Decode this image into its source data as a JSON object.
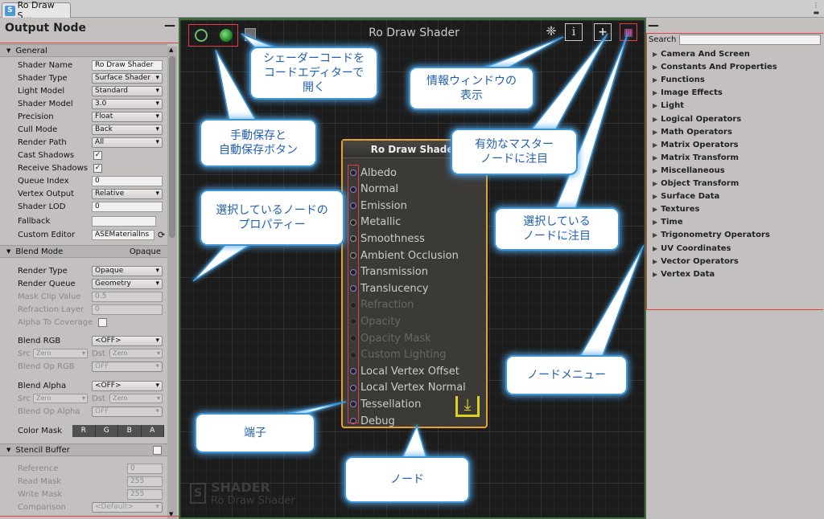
{
  "window": {
    "tab_title": "Ro Draw S...",
    "tab_icon": "S"
  },
  "left_panel": {
    "title": "Output Node",
    "minimize": "—",
    "general": {
      "header": "General",
      "shader_name": {
        "label": "Shader Name",
        "value": "Ro Draw Shader"
      },
      "shader_type": {
        "label": "Shader Type",
        "value": "Surface Shader"
      },
      "light_model": {
        "label": "Light Model",
        "value": "Standard"
      },
      "shader_model": {
        "label": "Shader Model",
        "value": "3.0"
      },
      "precision": {
        "label": "Precision",
        "value": "Float"
      },
      "cull_mode": {
        "label": "Cull Mode",
        "value": "Back"
      },
      "render_path": {
        "label": "Render Path",
        "value": "All"
      },
      "cast_shadows": {
        "label": "Cast Shadows",
        "checked": true
      },
      "receive_shadows": {
        "label": "Receive Shadows",
        "checked": true
      },
      "queue_index": {
        "label": "Queue Index",
        "value": "0"
      },
      "vertex_output": {
        "label": "Vertex Output",
        "value": "Relative"
      },
      "shader_lod": {
        "label": "Shader LOD",
        "value": "0"
      },
      "fallback": {
        "label": "Fallback",
        "value": ""
      },
      "custom_editor": {
        "label": "Custom Editor",
        "value": "ASEMaterialIns"
      }
    },
    "blend_mode": {
      "header": "Blend Mode",
      "value": "Opaque",
      "render_type": {
        "label": "Render Type",
        "value": "Opaque"
      },
      "render_queue": {
        "label": "Render Queue",
        "value": "Geometry"
      },
      "mask_clip_value": {
        "label": "Mask Clip Value",
        "value": "0.5"
      },
      "refraction_layer": {
        "label": "Refraction Layer",
        "value": "0"
      },
      "alpha_to_coverage": {
        "label": "Alpha To Coverage",
        "checked": false
      },
      "blend_rgb": {
        "label": "Blend RGB",
        "value": "<OFF>"
      },
      "src_rgb": {
        "label": "Src",
        "value": "Zero"
      },
      "dst_rgb": {
        "label": "Dst",
        "value": "Zero"
      },
      "blend_op_rgb": {
        "label": "Blend Op RGB",
        "value": "OFF"
      },
      "blend_alpha": {
        "label": "Blend Alpha",
        "value": "<OFF>"
      },
      "src_alpha": {
        "label": "Src",
        "value": "Zero"
      },
      "dst_alpha": {
        "label": "Dst",
        "value": "Zero"
      },
      "blend_op_alpha": {
        "label": "Blend Op Alpha",
        "value": "OFF"
      },
      "color_mask": {
        "label": "Color Mask",
        "channels": [
          "R",
          "G",
          "B",
          "A"
        ]
      }
    },
    "stencil": {
      "header": "Stencil Buffer",
      "reference": {
        "label": "Reference",
        "value": "0"
      },
      "read_mask": {
        "label": "Read Mask",
        "value": "255"
      },
      "write_mask": {
        "label": "Write Mask",
        "value": "255"
      },
      "comparison": {
        "label": "Comparison",
        "value": "<Default>"
      }
    }
  },
  "canvas": {
    "title": "Ro Draw Shader",
    "watermark": {
      "line1": "SHADER",
      "line2": "Ro Draw Shader"
    },
    "node": {
      "title": "Ro Draw Shader",
      "ports": [
        {
          "label": "Albedo",
          "state": "active"
        },
        {
          "label": "Normal",
          "state": "active"
        },
        {
          "label": "Emission",
          "state": "active"
        },
        {
          "label": "Metallic",
          "state": "grey"
        },
        {
          "label": "Smoothness",
          "state": "grey"
        },
        {
          "label": "Ambient Occlusion",
          "state": "grey"
        },
        {
          "label": "Transmission",
          "state": "active"
        },
        {
          "label": "Translucency",
          "state": "active"
        },
        {
          "label": "Refraction",
          "state": "disabled"
        },
        {
          "label": "Opacity",
          "state": "disabled"
        },
        {
          "label": "Opacity Mask",
          "state": "disabled"
        },
        {
          "label": "Custom Lighting",
          "state": "disabled"
        },
        {
          "label": "Local Vertex Offset",
          "state": "active"
        },
        {
          "label": "Local Vertex Normal",
          "state": "active"
        },
        {
          "label": "Tessellation",
          "state": "active"
        },
        {
          "label": "Debug",
          "state": "active"
        }
      ]
    },
    "toolbar_icons": [
      "clean-icon",
      "info-icon",
      "focus-master-icon",
      "focus-selected-icon"
    ]
  },
  "right_panel": {
    "minimize": "—",
    "search_label": "Search",
    "categories": [
      "Camera And Screen",
      "Constants And Properties",
      "Functions",
      "Image Effects",
      "Light",
      "Logical Operators",
      "Math Operators",
      "Matrix Operators",
      "Matrix Transform",
      "Miscellaneous",
      "Object Transform",
      "Surface Data",
      "Textures",
      "Time",
      "Trigonometry Operators",
      "UV Coordinates",
      "Vector Operators",
      "Vertex Data"
    ]
  },
  "callouts": {
    "shader_code": "シェーダーコードを\nコードエディターで\n開く",
    "info_window": "情報ウィンドウの\n表示",
    "save_buttons": "手動保存と\n自動保存ボタン",
    "focus_master": "有効なマスター\nノードに注目",
    "node_properties": "選択しているノードの\nプロパティー",
    "focus_selected": "選択している\nノードに注目",
    "node_menu": "ノードメニュー",
    "ports": "端子",
    "node": "ノード"
  },
  "colors": {
    "callout_border": "#3f95d4",
    "highlight_red": "#e04040",
    "node_border": "#e8a030",
    "port_active": "#8c7ce0"
  }
}
